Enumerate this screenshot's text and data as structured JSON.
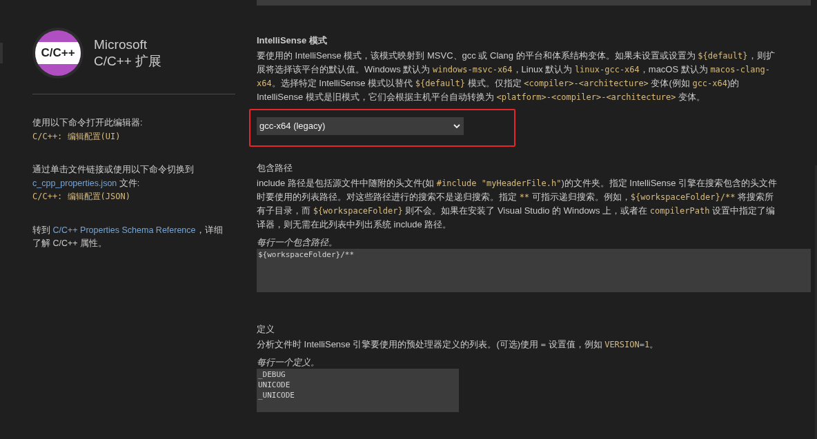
{
  "sidebar": {
    "logo_text": "C/C++",
    "title_lines": [
      "Microsoft",
      "C/C++ 扩展"
    ],
    "blocks": [
      {
        "lines": [
          [
            {
              "kind": "text",
              "text": "使用以下命令打开此编辑器:"
            }
          ],
          [
            {
              "kind": "command",
              "text": "C/C++: 编辑配置(UI)"
            }
          ]
        ]
      },
      {
        "lines": [
          [
            {
              "kind": "text",
              "text": "通过单击文件链接或使用以下命令切换到"
            }
          ],
          [
            {
              "kind": "link",
              "text": "c_cpp_properties.json"
            },
            {
              "kind": "text",
              "text": " 文件:"
            }
          ],
          [
            {
              "kind": "command",
              "text": "C/C++: 编辑配置(JSON)"
            }
          ]
        ]
      },
      {
        "lines": [
          [
            {
              "kind": "text",
              "text": "转到 "
            },
            {
              "kind": "link",
              "text": "C/C++ Properties Schema Reference"
            },
            {
              "kind": "text",
              "text": "，详细了解 C/C++ 属性。"
            }
          ]
        ]
      }
    ]
  },
  "sections": [
    {
      "kind": "select",
      "title": "IntelliSense 模式",
      "highlighted": true,
      "description": [
        {
          "kind": "text",
          "text": "要使用的 IntelliSense 模式，该模式映射到 MSVC、gcc 或 Clang 的平台和体系结构变体。如果未设置或设置为 "
        },
        {
          "kind": "code",
          "text": "${default}"
        },
        {
          "kind": "text",
          "text": "，则扩展将选择该平台的默认值。Windows 默认为 "
        },
        {
          "kind": "code",
          "text": "windows-msvc-x64"
        },
        {
          "kind": "text",
          "text": "，Linux 默认为 "
        },
        {
          "kind": "code",
          "text": "linux-gcc-x64"
        },
        {
          "kind": "text",
          "text": "，macOS 默认为 "
        },
        {
          "kind": "code",
          "text": "macos-clang-x64"
        },
        {
          "kind": "text",
          "text": "。选择特定 IntelliSense 模式以替代 "
        },
        {
          "kind": "code",
          "text": "${default}"
        },
        {
          "kind": "text",
          "text": " 模式。仅指定 "
        },
        {
          "kind": "code",
          "text": "<compiler>-<architecture>"
        },
        {
          "kind": "text",
          "text": " 变体(例如 "
        },
        {
          "kind": "code",
          "text": "gcc-x64"
        },
        {
          "kind": "text",
          "text": ")的 IntelliSense 模式是旧模式，它们会根据主机平台自动转换为 "
        },
        {
          "kind": "code",
          "text": "<platform>-<compiler>-<architecture>"
        },
        {
          "kind": "text",
          "text": " 变体。"
        }
      ],
      "value": "gcc-x64 (legacy)"
    },
    {
      "kind": "textarea",
      "title": "包含路径",
      "highlighted": false,
      "description": [
        {
          "kind": "text",
          "text": "include 路径是包括源文件中随附的头文件(如 "
        },
        {
          "kind": "code",
          "text": "#include \"myHeaderFile.h\""
        },
        {
          "kind": "text",
          "text": ")的文件夹。指定 IntelliSense 引擎在搜索包含的头文件时要使用的列表路径。对这些路径进行的搜索不是递归搜索。指定 "
        },
        {
          "kind": "code",
          "text": "**"
        },
        {
          "kind": "text",
          "text": " 可指示递归搜索。例如，"
        },
        {
          "kind": "code",
          "text": "${workspaceFolder}/**"
        },
        {
          "kind": "text",
          "text": " 将搜索所有子目录，而 "
        },
        {
          "kind": "code",
          "text": "${workspaceFolder}"
        },
        {
          "kind": "text",
          "text": " 则不会。如果在安装了 Visual Studio 的 Windows 上，或者在 "
        },
        {
          "kind": "code",
          "text": "compilerPath"
        },
        {
          "kind": "text",
          "text": " 设置中指定了编译器，则无需在此列表中列出系统 include 路径。"
        }
      ],
      "hint": "每行一个包含路径。",
      "value_lines": [
        "${workspaceFolder}/**"
      ],
      "wide": true
    },
    {
      "kind": "textarea",
      "title": "定义",
      "highlighted": false,
      "description": [
        {
          "kind": "text",
          "text": "分析文件时 IntelliSense 引擎要使用的预处理器定义的列表。(可选)使用 "
        },
        {
          "kind": "code",
          "text": "="
        },
        {
          "kind": "text",
          "text": " 设置值，例如 "
        },
        {
          "kind": "code",
          "text": "VERSION=1"
        },
        {
          "kind": "text",
          "text": "。"
        }
      ],
      "hint": "每行一个定义。",
      "value_lines": [
        "_DEBUG",
        "UNICODE",
        "_UNICODE"
      ],
      "wide": false
    }
  ]
}
